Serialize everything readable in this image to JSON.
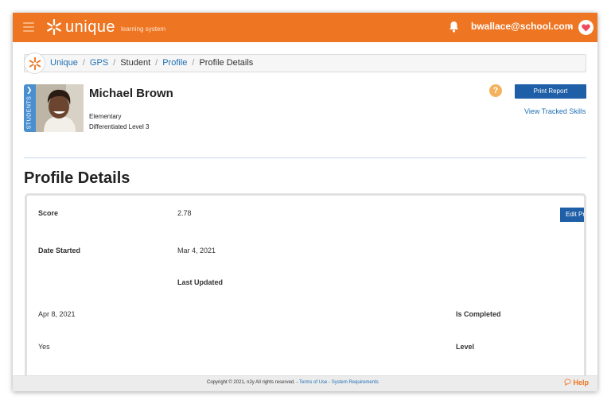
{
  "app": {
    "name": "unique",
    "subtitle": "learning system"
  },
  "user": {
    "email": "bwallace@school.com"
  },
  "breadcrumb": {
    "items": [
      "Unique",
      "GPS",
      "Student",
      "Profile",
      "Profile Details"
    ],
    "sep": "/"
  },
  "student": {
    "tab_label": "STUDENTS",
    "tab_arrow": "❯",
    "name": "Michael Brown",
    "grade": "Elementary",
    "level": "Differentiated Level 3"
  },
  "actions": {
    "help_symbol": "?",
    "print_report": "Print Report",
    "view_tracked_skills": "View Tracked Skills"
  },
  "page": {
    "title": "Profile Details"
  },
  "profile": {
    "score_label": "Score",
    "score_value": "2.78",
    "date_started_label": "Date Started",
    "date_started_value": "Mar 4, 2021",
    "last_updated_label": "Last Updated",
    "last_updated_value": "Apr 8, 2021",
    "is_completed_label": "Is Completed",
    "is_completed_value": "Yes",
    "level_label": "Level",
    "edit_button": "Edit Profile"
  },
  "footer": {
    "copyright": "Copyright © 2021, n2y All rights reserved. - ",
    "terms": "Terms of Use",
    "dash": " - ",
    "requirements": "System Requirements",
    "help": "Help"
  },
  "colors": {
    "brand_orange": "#ee7623",
    "button_blue": "#1f5fa8",
    "link_blue": "#1f6fb3"
  },
  "icons": [
    "menu-icon",
    "snowflake-logo-icon",
    "bell-icon",
    "chevron-down-icon",
    "heart-icon",
    "help-icon",
    "chat-bubble-icon"
  ]
}
